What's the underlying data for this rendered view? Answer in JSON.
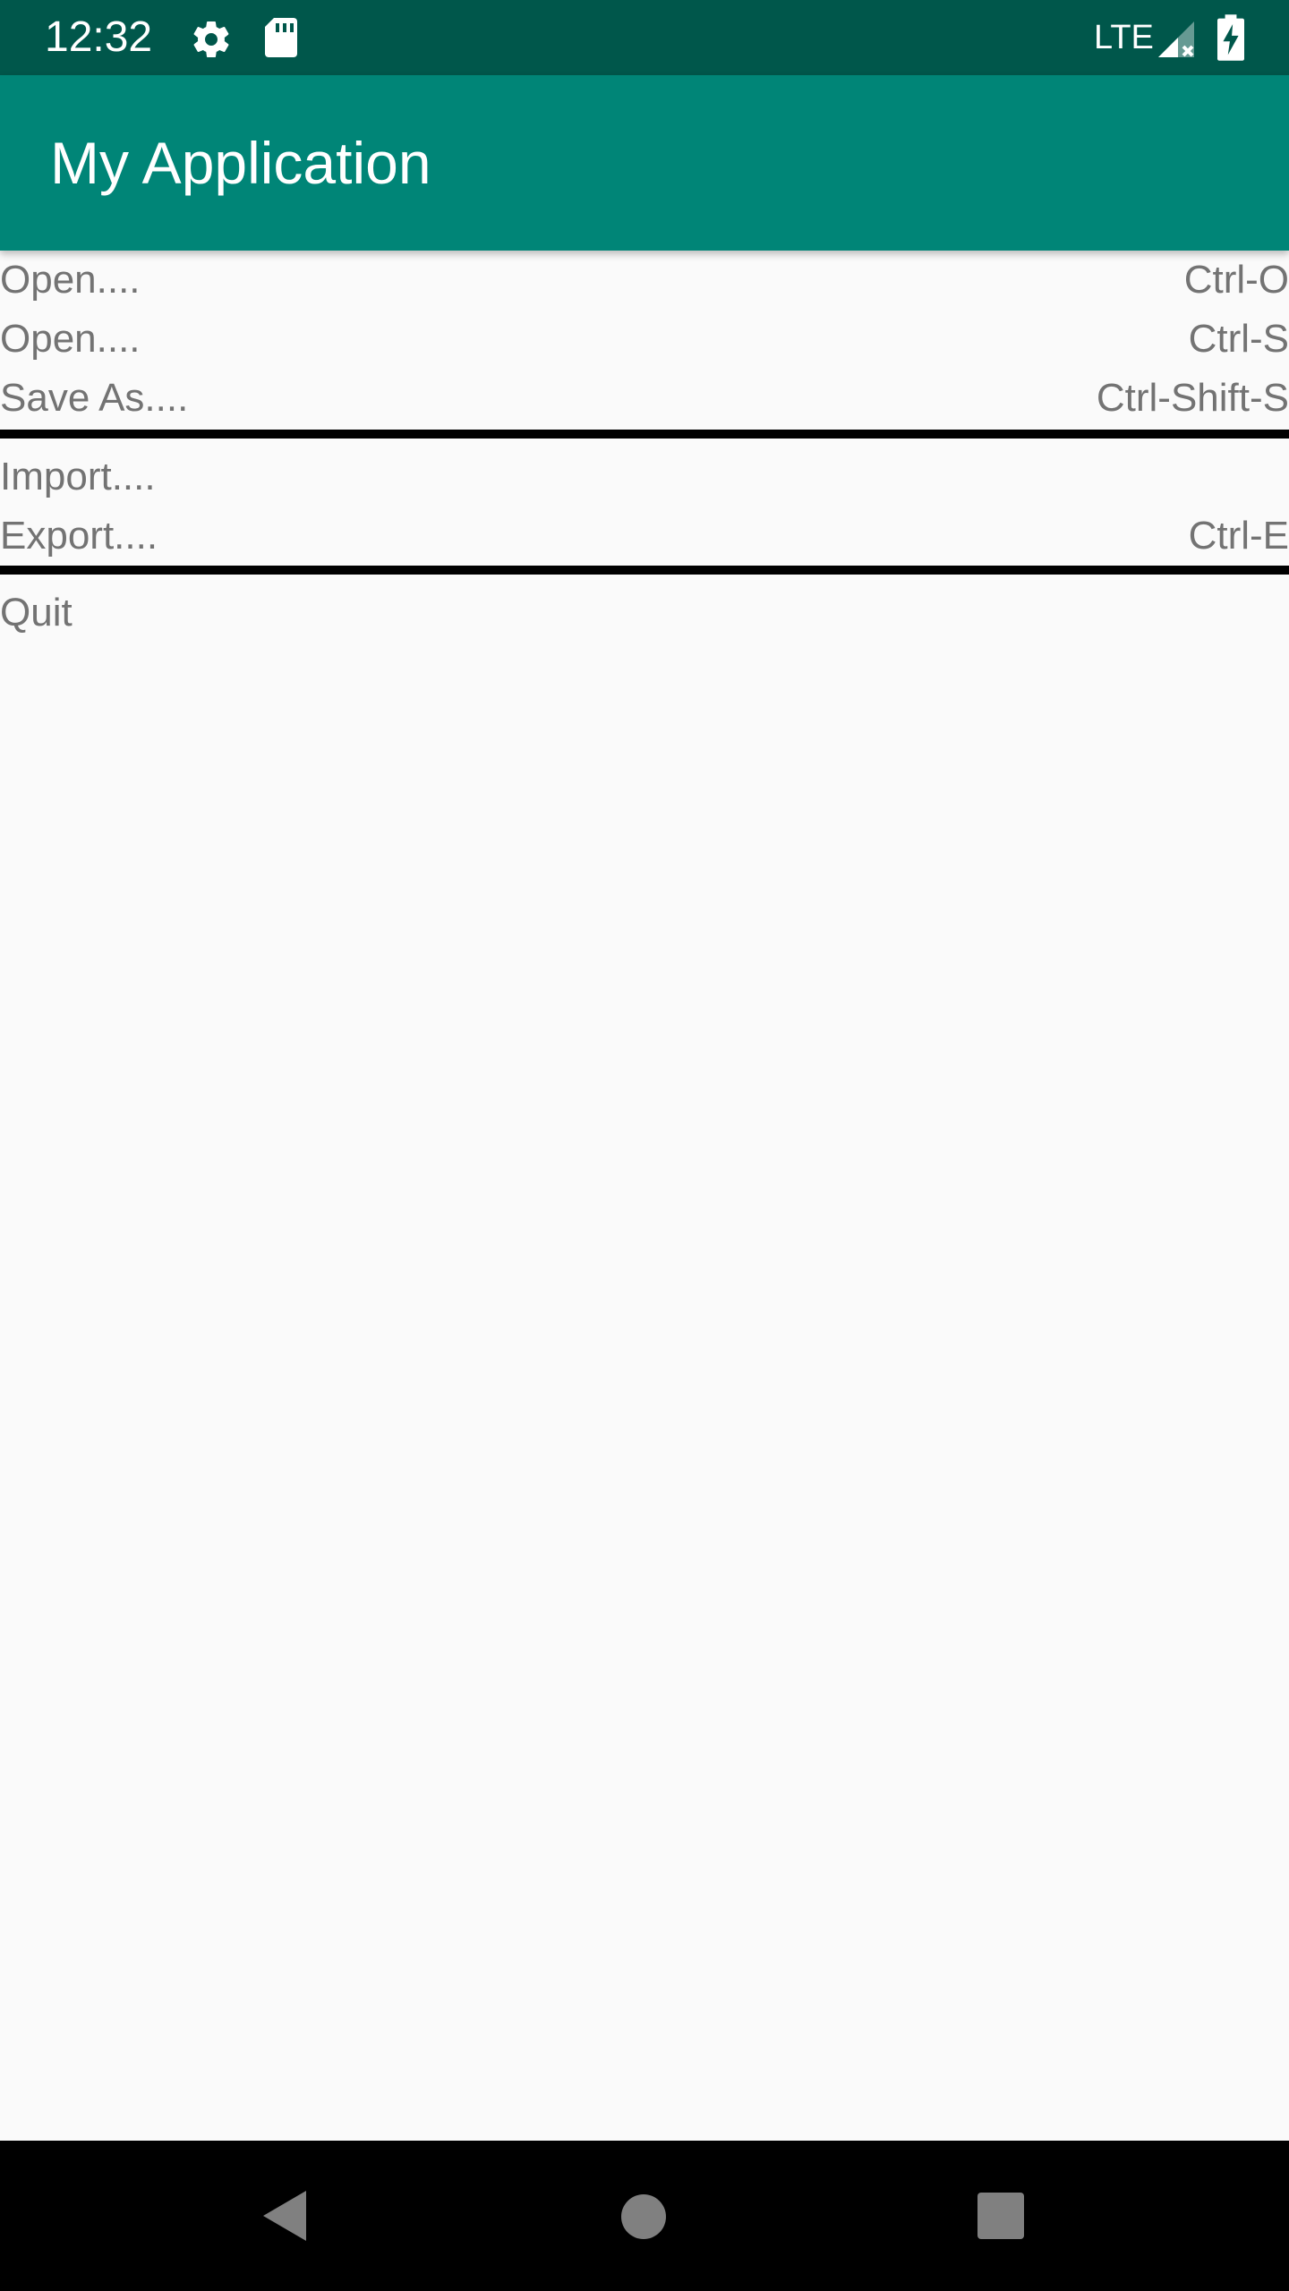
{
  "status_bar": {
    "time": "12:32",
    "network": "LTE",
    "icons": [
      "gear-icon",
      "sd-card-icon",
      "cell-signal-icon",
      "battery-charging-icon"
    ]
  },
  "app_bar": {
    "title": "My Application",
    "color": "#008577"
  },
  "menu": {
    "items": [
      {
        "label": "Open....",
        "shortcut": "Ctrl-O"
      },
      {
        "label": "Open....",
        "shortcut": "Ctrl-S"
      },
      {
        "label": "Save As....",
        "shortcut": "Ctrl-Shift-S"
      },
      {
        "label": "Import....",
        "shortcut": ""
      },
      {
        "label": "Export....",
        "shortcut": "Ctrl-E"
      },
      {
        "label": "Quit",
        "shortcut": ""
      }
    ]
  },
  "nav_bar": {
    "icons": [
      "back-icon",
      "home-icon",
      "recents-icon"
    ]
  },
  "colors": {
    "status_bar": "#00574b",
    "app_bar": "#008577",
    "menu_text": "#737373",
    "background": "#fafafa"
  }
}
